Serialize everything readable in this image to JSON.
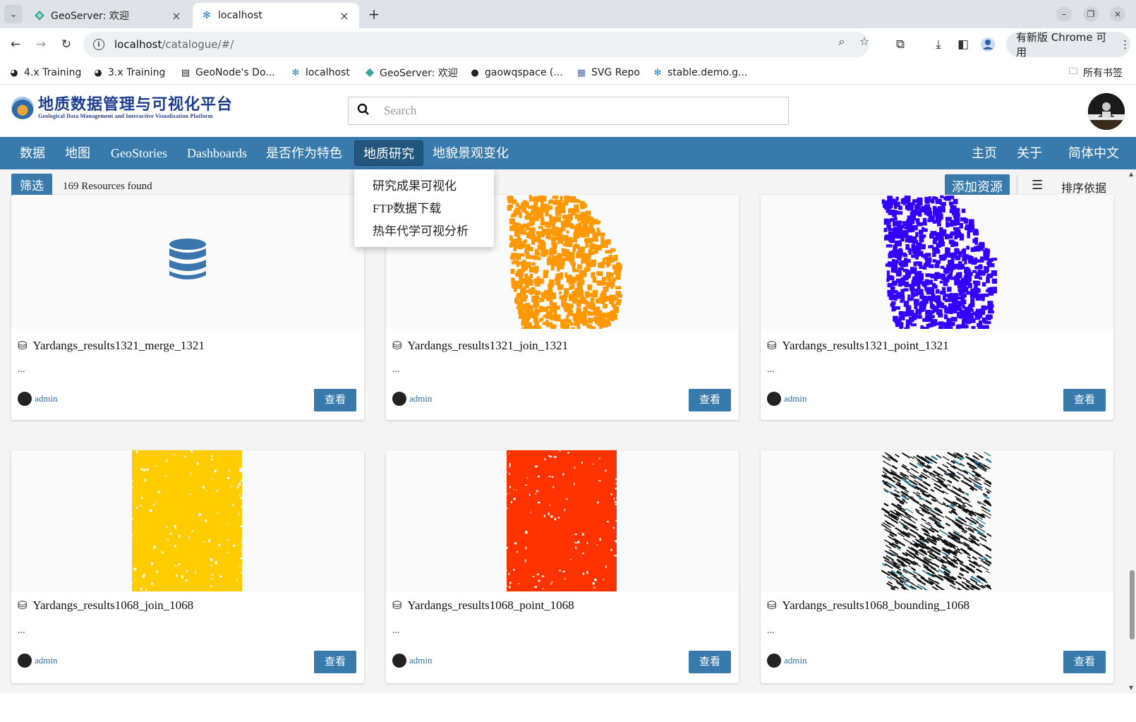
{
  "browser": {
    "tabs": [
      {
        "title": "GeoServer: 欢迎",
        "active": false
      },
      {
        "title": "localhost",
        "active": true
      }
    ],
    "address": {
      "host": "localhost",
      "path": "/catalogue/#/"
    },
    "update_label": "有新版 Chrome 可用",
    "bookmarks": [
      {
        "label": "4.x Training",
        "icon": "globe-dark-icon"
      },
      {
        "label": "3.x Training",
        "icon": "globe-dark-icon"
      },
      {
        "label": "GeoNode's Do...",
        "icon": "doc-icon"
      },
      {
        "label": "localhost",
        "icon": "snowflake-icon"
      },
      {
        "label": "GeoServer: 欢迎",
        "icon": "geoserver-icon"
      },
      {
        "label": "gaowqspace (...",
        "icon": "github-icon"
      },
      {
        "label": "SVG Repo",
        "icon": "svgrepo-icon"
      },
      {
        "label": "stable.demo.g...",
        "icon": "snowflake-icon"
      }
    ],
    "all_bookmarks_label": "所有书签"
  },
  "site": {
    "logo_title": "地质数据管理与可视化平台",
    "logo_subtitle": "Geological Data Management and Interactive Visualization Platform",
    "search_placeholder": "Search"
  },
  "nav": {
    "left": [
      "数据",
      "地图",
      "GeoStories",
      "Dashboards",
      "是否作为特色",
      "地质研究",
      "地貌景观变化"
    ],
    "right": [
      "主页",
      "关于",
      "简体中文"
    ],
    "active": "地质研究",
    "dropdown": [
      "研究成果可视化",
      "FTP数据下载",
      "热年代学可视分析"
    ]
  },
  "toolbar": {
    "filter_label": "筛选",
    "resource_count": "169 Resources found",
    "add_label": "添加资源",
    "sort_label": "排序依据"
  },
  "cards": [
    {
      "title": "Yardangs_results1321_merge_1321",
      "desc": "...",
      "owner": "admin",
      "action": "查看",
      "thumb": "database-icon",
      "color": "#3a76ad"
    },
    {
      "title": "Yardangs_results1321_join_1321",
      "desc": "...",
      "owner": "admin",
      "action": "查看",
      "thumb": "scatter",
      "color": "#ff9800"
    },
    {
      "title": "Yardangs_results1321_point_1321",
      "desc": "...",
      "owner": "admin",
      "action": "查看",
      "thumb": "scatter",
      "color": "#3300ff"
    },
    {
      "title": "Yardangs_results1068_join_1068",
      "desc": "...",
      "owner": "admin",
      "action": "查看",
      "thumb": "block",
      "color": "#ffcc00"
    },
    {
      "title": "Yardangs_results1068_point_1068",
      "desc": "...",
      "owner": "admin",
      "action": "查看",
      "thumb": "block",
      "color": "#ff3300"
    },
    {
      "title": "Yardangs_results1068_bounding_1068",
      "desc": "...",
      "owner": "admin",
      "action": "查看",
      "thumb": "hatch",
      "color": "#111111"
    }
  ]
}
